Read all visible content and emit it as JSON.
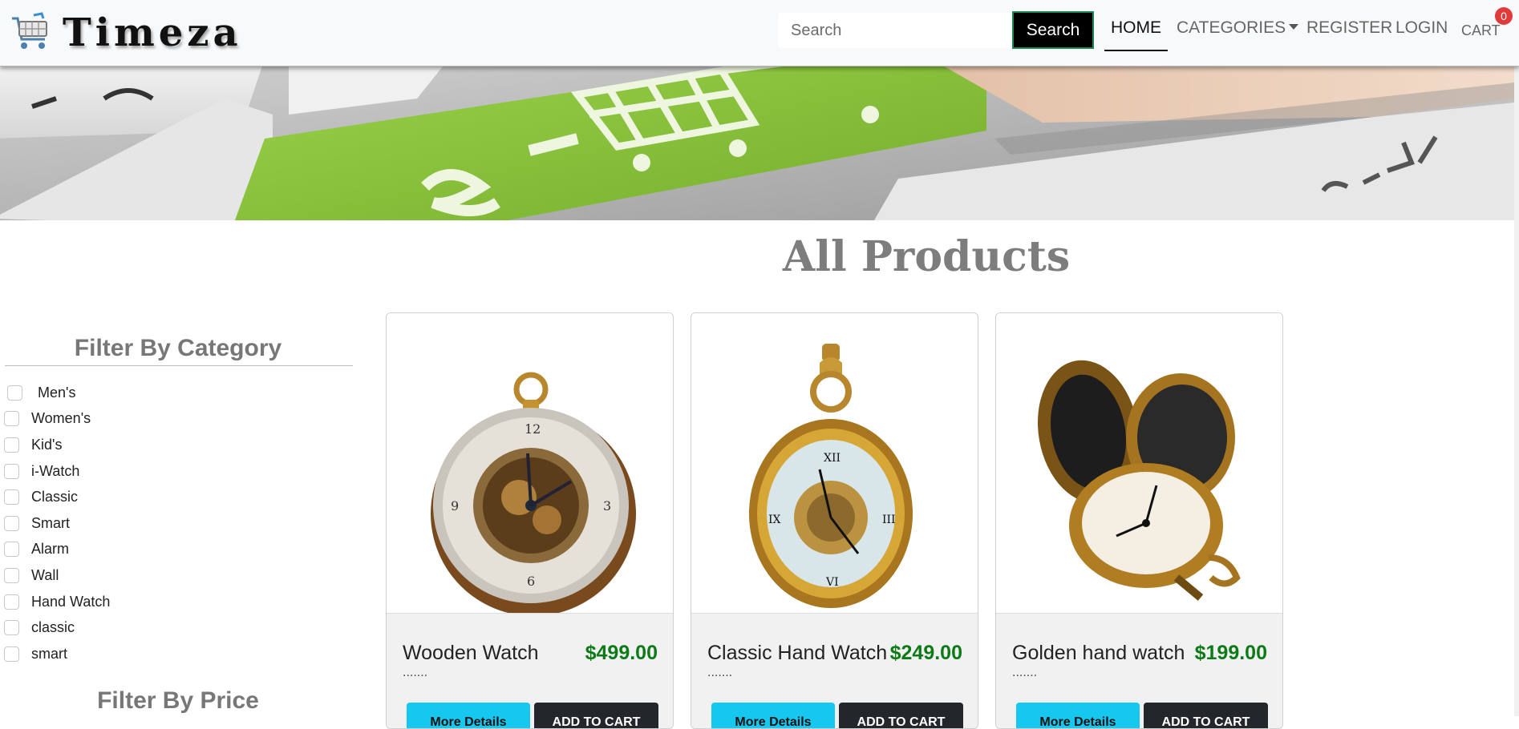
{
  "brand": {
    "name": "Timeza",
    "logo_icon": "shopping-cart-icon"
  },
  "search": {
    "placeholder": "Search",
    "button_label": "Search"
  },
  "nav": {
    "home": "HOME",
    "categories": "CATEGORIES",
    "register": "REGISTER",
    "login": "LOGIN",
    "cart": "CART",
    "cart_count": "0"
  },
  "banner": {
    "image": "e-commerce keyboard key with shopping cart",
    "icon": "shopping-cart-icon"
  },
  "main": {
    "title": "All Products"
  },
  "sidebar": {
    "category_title": "Filter By Category",
    "categories": [
      "Men's",
      "Women's",
      "Kid's",
      "i-Watch",
      "Classic",
      "Smart",
      "Alarm",
      "Wall",
      "Hand Watch",
      "classic",
      "smart"
    ],
    "price_title": "Filter By Price"
  },
  "products": [
    {
      "name": "Wooden Watch",
      "price": "$499.00",
      "description": ".......",
      "details_label": "More Details",
      "cart_label": "ADD TO CART",
      "image_icon": "pocket-watch-icon"
    },
    {
      "name": "Classic Hand Watch",
      "price": "$249.00",
      "description": ".......",
      "details_label": "More Details",
      "cart_label": "ADD TO CART",
      "image_icon": "pocket-watch-icon"
    },
    {
      "name": "Golden hand watch",
      "price": "$199.00",
      "description": ".......",
      "details_label": "More Details",
      "cart_label": "ADD TO CART",
      "image_icon": "pocket-watch-icon"
    }
  ],
  "colors": {
    "price": "#0c7a17",
    "details_button": "#16c8ef",
    "cart_button": "#23272b",
    "badge": "#e03a3a",
    "banner_key": "#8cc63f"
  }
}
